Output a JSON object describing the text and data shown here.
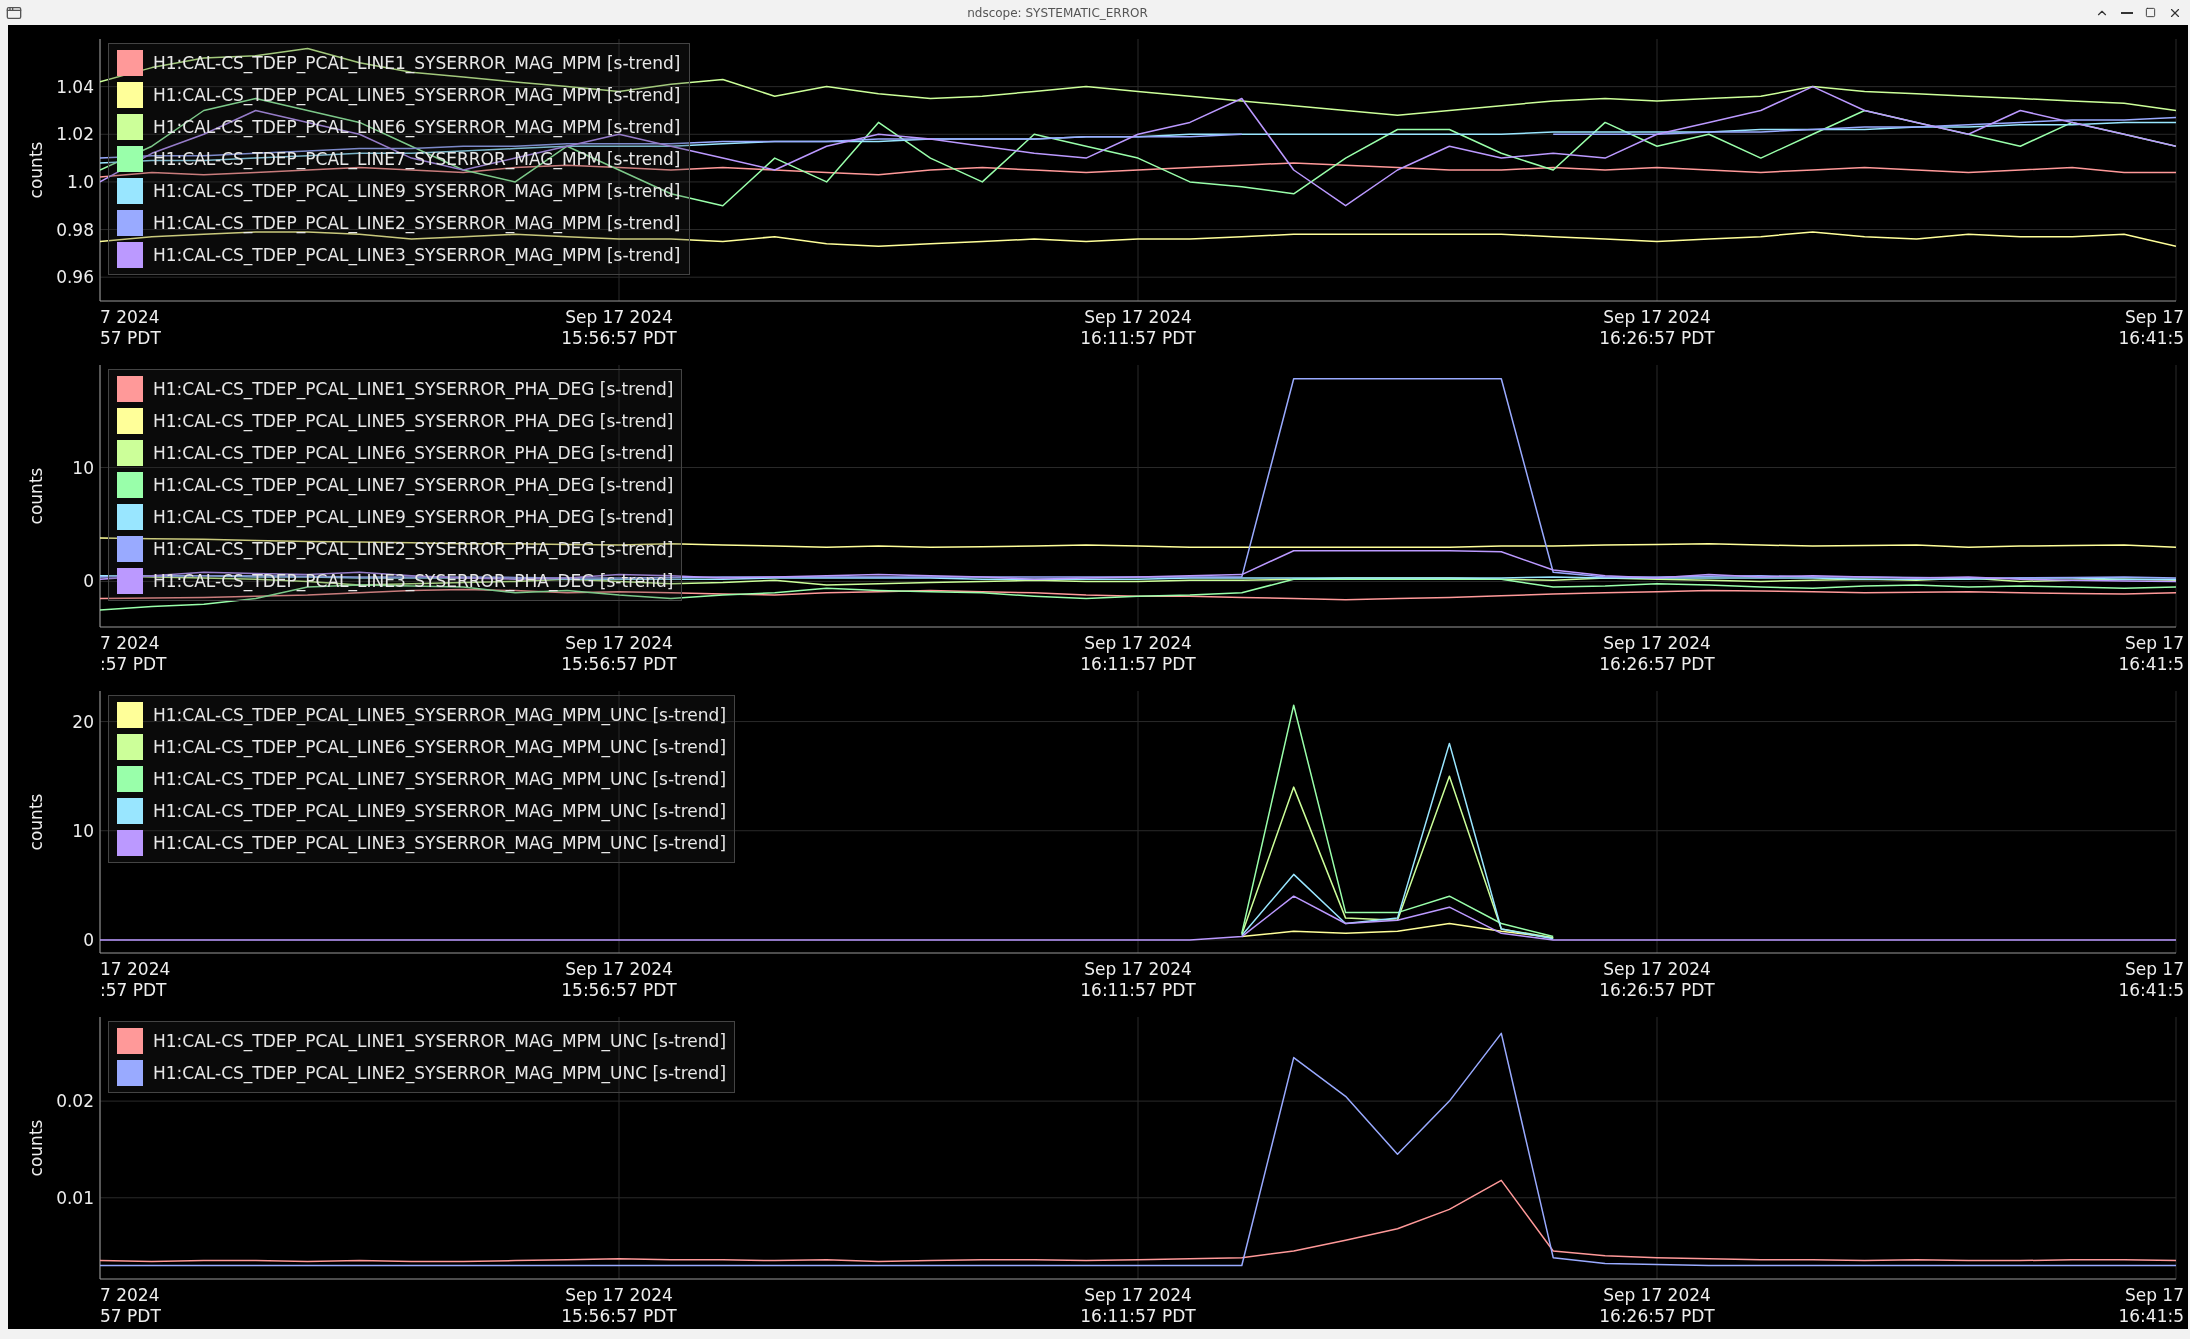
{
  "window": {
    "title": "ndscope: SYSTEMATIC_ERROR"
  },
  "plots": [
    {
      "chart_data": {
        "type": "line",
        "ylabel": "counts",
        "grid": true,
        "legend": true,
        "ylim": [
          0.95,
          1.06
        ],
        "yticks": [
          0.96,
          0.98,
          {
            "value": 1.0,
            "label": "1.0"
          },
          1.02,
          1.04
        ],
        "categories": [
          "7 2024\n57 PDT",
          null,
          null,
          null,
          null,
          null,
          null,
          null,
          null,
          null,
          "Sep 17 2024\n15:56:57 PDT",
          null,
          null,
          null,
          null,
          null,
          null,
          null,
          null,
          null,
          "Sep 17 2024\n16:11:57 PDT",
          null,
          null,
          null,
          null,
          null,
          null,
          null,
          null,
          null,
          "Sep 17 2024\n16:26:57 PDT",
          null,
          null,
          null,
          null,
          null,
          null,
          null,
          null,
          null,
          "Sep 17\n16:41:5"
        ],
        "series": [
          {
            "name": "H1:CAL-CS_TDEP_PCAL_LINE1_SYSERROR_MAG_MPM [s-trend]",
            "color": "#ff9999",
            "values": [
              1.002,
              1.004,
              1.003,
              1.004,
              1.005,
              1.006,
              1.005,
              1.004,
              1.006,
              1.007,
              1.006,
              1.005,
              1.006,
              1.005,
              1.004,
              1.003,
              1.005,
              1.006,
              1.005,
              1.004,
              1.005,
              1.006,
              1.007,
              1.008,
              1.007,
              1.006,
              1.005,
              1.005,
              1.006,
              1.005,
              1.006,
              1.005,
              1.004,
              1.005,
              1.006,
              1.005,
              1.004,
              1.005,
              1.006,
              1.004,
              1.004
            ]
          },
          {
            "name": "H1:CAL-CS_TDEP_PCAL_LINE5_SYSERROR_MAG_MPM [s-trend]",
            "color": "#ffff99",
            "values": [
              0.975,
              0.977,
              0.978,
              0.979,
              0.979,
              0.978,
              0.976,
              0.977,
              0.978,
              0.977,
              0.976,
              0.976,
              0.975,
              0.977,
              0.974,
              0.973,
              0.974,
              0.975,
              0.976,
              0.975,
              0.976,
              0.976,
              0.977,
              0.978,
              0.978,
              0.978,
              0.978,
              0.978,
              0.977,
              0.976,
              0.975,
              0.976,
              0.977,
              0.979,
              0.977,
              0.976,
              0.978,
              0.977,
              0.977,
              0.978,
              0.973
            ]
          },
          {
            "name": "H1:CAL-CS_TDEP_PCAL_LINE6_SYSERROR_MAG_MPM [s-trend]",
            "color": "#ccff99",
            "values": [
              1.042,
              1.048,
              1.052,
              1.053,
              1.056,
              1.05,
              1.046,
              1.044,
              1.042,
              1.04,
              1.038,
              1.041,
              1.043,
              1.036,
              1.04,
              1.037,
              1.035,
              1.036,
              1.038,
              1.04,
              1.038,
              1.036,
              1.034,
              1.032,
              1.03,
              1.028,
              1.03,
              1.032,
              1.034,
              1.035,
              1.034,
              1.035,
              1.036,
              1.04,
              1.038,
              1.037,
              1.036,
              1.035,
              1.034,
              1.033,
              1.03
            ]
          },
          {
            "name": "H1:CAL-CS_TDEP_PCAL_LINE7_SYSERROR_MAG_MPM [s-trend]",
            "color": "#99ffaa",
            "values": [
              1.005,
              1.015,
              1.03,
              1.035,
              1.03,
              1.025,
              1.015,
              1.005,
              1.0,
              1.015,
              1.005,
              0.995,
              0.99,
              1.01,
              1.0,
              1.025,
              1.01,
              1.0,
              1.02,
              1.015,
              1.01,
              1.0,
              0.998,
              0.995,
              1.01,
              1.022,
              1.022,
              1.012,
              1.005,
              1.025,
              1.015,
              1.02,
              1.01,
              1.02,
              1.03,
              1.025,
              1.02,
              1.015,
              1.025,
              1.02,
              1.015
            ]
          },
          {
            "name": "H1:CAL-CS_TDEP_PCAL_LINE9_SYSERROR_MAG_MPM [s-trend]",
            "color": "#99e6ff",
            "values": [
              1.008,
              1.009,
              1.009,
              1.01,
              1.011,
              1.012,
              1.012,
              1.013,
              1.014,
              1.015,
              1.015,
              1.015,
              1.016,
              1.017,
              1.017,
              1.017,
              1.018,
              1.018,
              1.018,
              1.019,
              1.019,
              1.02,
              1.02,
              1.02,
              1.02,
              1.02,
              1.02,
              1.02,
              1.021,
              1.021,
              1.021,
              1.021,
              1.022,
              1.022,
              1.022,
              1.023,
              1.023,
              1.024,
              1.024,
              1.025,
              1.025
            ]
          },
          {
            "name": "H1:CAL-CS_TDEP_PCAL_LINE2_SYSERROR_MAG_MPM [s-trend]",
            "color": "#99aaff",
            "values": [
              1.01,
              1.011,
              1.011,
              1.012,
              1.013,
              1.014,
              1.014,
              1.015,
              1.015,
              1.016,
              1.016,
              1.016,
              1.017,
              1.017,
              1.017,
              1.018,
              1.018,
              1.018,
              1.018,
              1.019,
              1.019,
              1.019,
              1.02,
              null,
              null,
              null,
              null,
              null,
              1.02,
              1.02,
              1.02,
              1.021,
              1.021,
              1.022,
              1.023,
              1.023,
              1.024,
              1.025,
              1.026,
              1.026,
              1.027
            ]
          },
          {
            "name": "H1:CAL-CS_TDEP_PCAL_LINE3_SYSERROR_MAG_MPM [s-trend]",
            "color": "#bb99ff",
            "values": [
              1.0,
              1.012,
              1.02,
              1.03,
              1.025,
              1.02,
              1.01,
              1.005,
              1.01,
              1.015,
              1.02,
              1.015,
              1.01,
              1.005,
              1.015,
              1.02,
              1.018,
              1.015,
              1.012,
              1.01,
              1.02,
              1.025,
              1.035,
              1.005,
              0.99,
              1.005,
              1.015,
              1.01,
              1.012,
              1.01,
              1.02,
              1.025,
              1.03,
              1.04,
              1.03,
              1.025,
              1.02,
              1.03,
              1.025,
              1.02,
              1.015
            ]
          }
        ]
      }
    },
    {
      "chart_data": {
        "type": "line",
        "ylabel": "counts",
        "grid": true,
        "legend": true,
        "ylim": [
          -4,
          19
        ],
        "yticks": [
          0,
          10
        ],
        "categories": [
          "7 2024\n:57 PDT",
          null,
          null,
          null,
          null,
          null,
          null,
          null,
          null,
          null,
          "Sep 17 2024\n15:56:57 PDT",
          null,
          null,
          null,
          null,
          null,
          null,
          null,
          null,
          null,
          "Sep 17 2024\n16:11:57 PDT",
          null,
          null,
          null,
          null,
          null,
          null,
          null,
          null,
          null,
          "Sep 17 2024\n16:26:57 PDT",
          null,
          null,
          null,
          null,
          null,
          null,
          null,
          null,
          null,
          "Sep 17\n16:41:5"
        ],
        "series": [
          {
            "name": "H1:CAL-CS_TDEP_PCAL_LINE1_SYSERROR_PHA_DEG [s-trend]",
            "color": "#ff9999",
            "values": [
              -1.5,
              -1.45,
              -1.4,
              -1.3,
              -1.2,
              -1.0,
              -0.8,
              -0.7,
              -0.8,
              -1.0,
              -0.9,
              -1.0,
              -1.1,
              -1.2,
              -1.0,
              -0.9,
              -0.8,
              -0.9,
              -1.0,
              -1.2,
              -1.3,
              -1.3,
              -1.4,
              -1.5,
              -1.6,
              -1.5,
              -1.4,
              -1.25,
              -1.1,
              -1.0,
              -0.9,
              -0.8,
              -0.85,
              -0.9,
              -1.0,
              -0.95,
              -0.9,
              -1.0,
              -1.05,
              -1.1,
              -1.0
            ]
          },
          {
            "name": "H1:CAL-CS_TDEP_PCAL_LINE5_SYSERROR_PHA_DEG [s-trend]",
            "color": "#ffff99",
            "values": [
              3.8,
              3.75,
              3.7,
              3.6,
              3.5,
              3.45,
              3.4,
              3.3,
              3.3,
              3.25,
              3.2,
              3.3,
              3.2,
              3.1,
              3.0,
              3.1,
              3.0,
              3.05,
              3.1,
              3.2,
              3.1,
              3.0,
              3.0,
              3.0,
              3.0,
              3.0,
              3.0,
              3.1,
              3.1,
              3.2,
              3.25,
              3.3,
              3.2,
              3.1,
              3.15,
              3.2,
              3.0,
              3.1,
              3.15,
              3.2,
              3.0
            ]
          },
          {
            "name": "H1:CAL-CS_TDEP_PCAL_LINE6_SYSERROR_PHA_DEG [s-trend]",
            "color": "#ccff99",
            "values": [
              0.5,
              0.4,
              0.3,
              0.2,
              0.0,
              -0.3,
              -0.2,
              -0.1,
              0.0,
              0.2,
              0.0,
              -0.2,
              -0.1,
              0.1,
              -0.3,
              -0.2,
              -0.1,
              0.0,
              0.1,
              0.0,
              0.0,
              0.1,
              0.1,
              0.2,
              0.3,
              0.3,
              0.3,
              0.2,
              0.1,
              0.3,
              0.2,
              0.1,
              0.0,
              0.1,
              0.2,
              0.1,
              0.3,
              0.0,
              0.1,
              0.2,
              0.1
            ]
          },
          {
            "name": "H1:CAL-CS_TDEP_PCAL_LINE7_SYSERROR_PHA_DEG [s-trend]",
            "color": "#99ffaa",
            "values": [
              -2.5,
              -2.2,
              -2.0,
              -1.5,
              -0.5,
              -0.3,
              -0.4,
              -0.5,
              -1.0,
              -0.8,
              -1.2,
              -1.5,
              -1.2,
              -1.0,
              -0.6,
              -0.8,
              -0.9,
              -1.0,
              -1.3,
              -1.5,
              -1.3,
              -1.2,
              -1.0,
              0.2,
              0.2,
              0.2,
              0.2,
              0.2,
              -0.5,
              -0.4,
              -0.2,
              -0.3,
              -0.5,
              -0.6,
              -0.4,
              -0.3,
              -0.5,
              -0.4,
              -0.5,
              -0.6,
              -0.5
            ]
          },
          {
            "name": "H1:CAL-CS_TDEP_PCAL_LINE9_SYSERROR_PHA_DEG [s-trend]",
            "color": "#99e6ff",
            "values": [
              0.5,
              0.5,
              0.5,
              0.4,
              0.4,
              0.3,
              0.3,
              0.3,
              0.3,
              0.2,
              0.2,
              0.2,
              0.2,
              0.3,
              0.3,
              0.3,
              0.3,
              0.2,
              0.2,
              0.2,
              0.2,
              0.3,
              0.3,
              0.3,
              0.3,
              0.3,
              0.3,
              0.3,
              0.4,
              0.3,
              0.3,
              0.3,
              0.3,
              0.3,
              0.2,
              0.2,
              0.2,
              0.3,
              0.3,
              0.2,
              0.2
            ]
          },
          {
            "name": "H1:CAL-CS_TDEP_PCAL_LINE2_SYSERROR_PHA_DEG [s-trend]",
            "color": "#99aaff",
            "values": [
              0.4,
              0.45,
              0.5,
              0.5,
              0.45,
              0.4,
              0.4,
              0.4,
              0.35,
              0.3,
              0.3,
              0.35,
              0.4,
              0.4,
              0.4,
              0.4,
              0.4,
              0.4,
              0.4,
              0.4,
              0.4,
              0.4,
              0.4,
              17.8,
              17.8,
              17.8,
              17.8,
              17.8,
              0.8,
              0.4,
              0.4,
              0.45,
              0.5,
              0.4,
              0.4,
              0.35,
              0.3,
              0.3,
              0.35,
              0.4,
              0.3
            ]
          },
          {
            "name": "H1:CAL-CS_TDEP_PCAL_LINE3_SYSERROR_PHA_DEG [s-trend]",
            "color": "#bb99ff",
            "values": [
              0.2,
              0.5,
              0.8,
              0.7,
              0.6,
              0.8,
              0.5,
              0.3,
              0.2,
              0.3,
              0.6,
              0.5,
              0.3,
              0.4,
              0.5,
              0.6,
              0.5,
              0.4,
              0.2,
              0.3,
              0.4,
              0.5,
              0.6,
              2.7,
              2.7,
              2.7,
              2.7,
              2.6,
              1.0,
              0.5,
              0.3,
              0.6,
              0.4,
              0.5,
              0.4,
              0.3,
              0.4,
              0.2,
              0.1,
              0.05,
              0.0
            ]
          }
        ]
      }
    },
    {
      "chart_data": {
        "type": "line",
        "ylabel": "counts",
        "grid": true,
        "legend": true,
        "ylim": [
          -1.2,
          22.8
        ],
        "yticks": [
          0,
          10,
          20
        ],
        "categories": [
          "17 2024\n:57 PDT",
          null,
          null,
          null,
          null,
          null,
          null,
          null,
          null,
          null,
          "Sep 17 2024\n15:56:57 PDT",
          null,
          null,
          null,
          null,
          null,
          null,
          null,
          null,
          null,
          "Sep 17 2024\n16:11:57 PDT",
          null,
          null,
          null,
          null,
          null,
          null,
          null,
          null,
          null,
          "Sep 17 2024\n16:26:57 PDT",
          null,
          null,
          null,
          null,
          null,
          null,
          null,
          null,
          null,
          "Sep 17\n16:41:5"
        ],
        "series": [
          {
            "name": "H1:CAL-CS_TDEP_PCAL_LINE5_SYSERROR_MAG_MPM_UNC [s-trend]",
            "color": "#ffff99",
            "values": [
              null,
              null,
              null,
              null,
              null,
              null,
              null,
              null,
              null,
              null,
              null,
              null,
              null,
              null,
              null,
              null,
              null,
              null,
              null,
              null,
              null,
              null,
              0.3,
              0.8,
              0.6,
              0.8,
              1.5,
              0.8,
              0.2,
              null,
              null,
              null,
              null,
              null,
              null,
              null,
              null,
              null,
              null,
              null,
              null
            ]
          },
          {
            "name": "H1:CAL-CS_TDEP_PCAL_LINE6_SYSERROR_MAG_MPM_UNC [s-trend]",
            "color": "#ccff99",
            "values": [
              null,
              null,
              null,
              null,
              null,
              null,
              null,
              null,
              null,
              null,
              null,
              null,
              null,
              null,
              null,
              null,
              null,
              null,
              null,
              null,
              null,
              null,
              0.5,
              14,
              2.0,
              1.8,
              15,
              1.0,
              0.2,
              null,
              null,
              null,
              null,
              null,
              null,
              null,
              null,
              null,
              null,
              null,
              null
            ]
          },
          {
            "name": "H1:CAL-CS_TDEP_PCAL_LINE7_SYSERROR_MAG_MPM_UNC [s-trend]",
            "color": "#99ffaa",
            "values": [
              null,
              null,
              null,
              null,
              null,
              null,
              null,
              null,
              null,
              null,
              null,
              null,
              null,
              null,
              null,
              null,
              null,
              null,
              null,
              null,
              null,
              null,
              0.6,
              21.5,
              2.5,
              2.5,
              4.0,
              1.5,
              0.3,
              null,
              null,
              null,
              null,
              null,
              null,
              null,
              null,
              null,
              null,
              null,
              null
            ]
          },
          {
            "name": "H1:CAL-CS_TDEP_PCAL_LINE9_SYSERROR_MAG_MPM_UNC [s-trend]",
            "color": "#99e6ff",
            "values": [
              null,
              null,
              null,
              null,
              null,
              null,
              null,
              null,
              null,
              null,
              null,
              null,
              null,
              null,
              null,
              null,
              null,
              null,
              null,
              null,
              null,
              null,
              0.4,
              6,
              1.5,
              2.0,
              18,
              1.0,
              0.1,
              null,
              null,
              null,
              null,
              null,
              null,
              null,
              null,
              null,
              null,
              null,
              null
            ]
          },
          {
            "name": "H1:CAL-CS_TDEP_PCAL_LINE3_SYSERROR_MAG_MPM_UNC [s-trend]",
            "color": "#bb99ff",
            "values": [
              0,
              0,
              0,
              0,
              0,
              0,
              0,
              0,
              0,
              0,
              0,
              0,
              0,
              0,
              0,
              0,
              0,
              0,
              0,
              0,
              0,
              0,
              0.3,
              4,
              1.5,
              1.8,
              3,
              0.6,
              0,
              0,
              0,
              0,
              0,
              0,
              0,
              0,
              0,
              0,
              0,
              0,
              0
            ]
          }
        ]
      }
    },
    {
      "chart_data": {
        "type": "line",
        "ylabel": "counts",
        "grid": true,
        "legend": true,
        "ylim": [
          0.0016,
          0.0287
        ],
        "yticks": [
          0.01,
          0.02
        ],
        "categories": [
          "7 2024\n57 PDT",
          null,
          null,
          null,
          null,
          null,
          null,
          null,
          null,
          null,
          "Sep 17 2024\n15:56:57 PDT",
          null,
          null,
          null,
          null,
          null,
          null,
          null,
          null,
          null,
          "Sep 17 2024\n16:11:57 PDT",
          null,
          null,
          null,
          null,
          null,
          null,
          null,
          null,
          null,
          "Sep 17 2024\n16:26:57 PDT",
          null,
          null,
          null,
          null,
          null,
          null,
          null,
          null,
          null,
          "Sep 17\n16:41:5"
        ],
        "series": [
          {
            "name": "H1:CAL-CS_TDEP_PCAL_LINE1_SYSERROR_MAG_MPM_UNC [s-trend]",
            "color": "#ff9999",
            "values": [
              0.0035,
              0.0034,
              0.0035,
              0.0035,
              0.0034,
              0.0035,
              0.0034,
              0.0034,
              0.0035,
              0.0036,
              0.0037,
              0.0036,
              0.0036,
              0.0035,
              0.0036,
              0.0034,
              0.0035,
              0.0036,
              0.0036,
              0.0035,
              0.0036,
              0.0037,
              0.0038,
              0.0045,
              0.0056,
              0.0068,
              0.0088,
              0.0118,
              0.0045,
              0.004,
              0.0038,
              0.0037,
              0.0036,
              0.0036,
              0.0035,
              0.0036,
              0.0035,
              0.0035,
              0.0036,
              0.0036,
              0.0035
            ]
          },
          {
            "name": "H1:CAL-CS_TDEP_PCAL_LINE2_SYSERROR_MAG_MPM_UNC [s-trend]",
            "color": "#99aaff",
            "values": [
              0.003,
              0.003,
              0.003,
              0.003,
              0.003,
              0.003,
              0.003,
              0.003,
              0.003,
              0.003,
              0.003,
              0.003,
              0.003,
              0.003,
              0.003,
              0.003,
              0.003,
              0.003,
              0.003,
              0.003,
              0.003,
              0.003,
              0.003,
              0.0245,
              0.0205,
              0.0145,
              0.02,
              0.027,
              0.0038,
              0.0032,
              0.0031,
              0.003,
              0.003,
              0.003,
              0.003,
              0.003,
              0.003,
              0.003,
              0.003,
              0.003,
              0.003
            ]
          }
        ]
      }
    }
  ]
}
